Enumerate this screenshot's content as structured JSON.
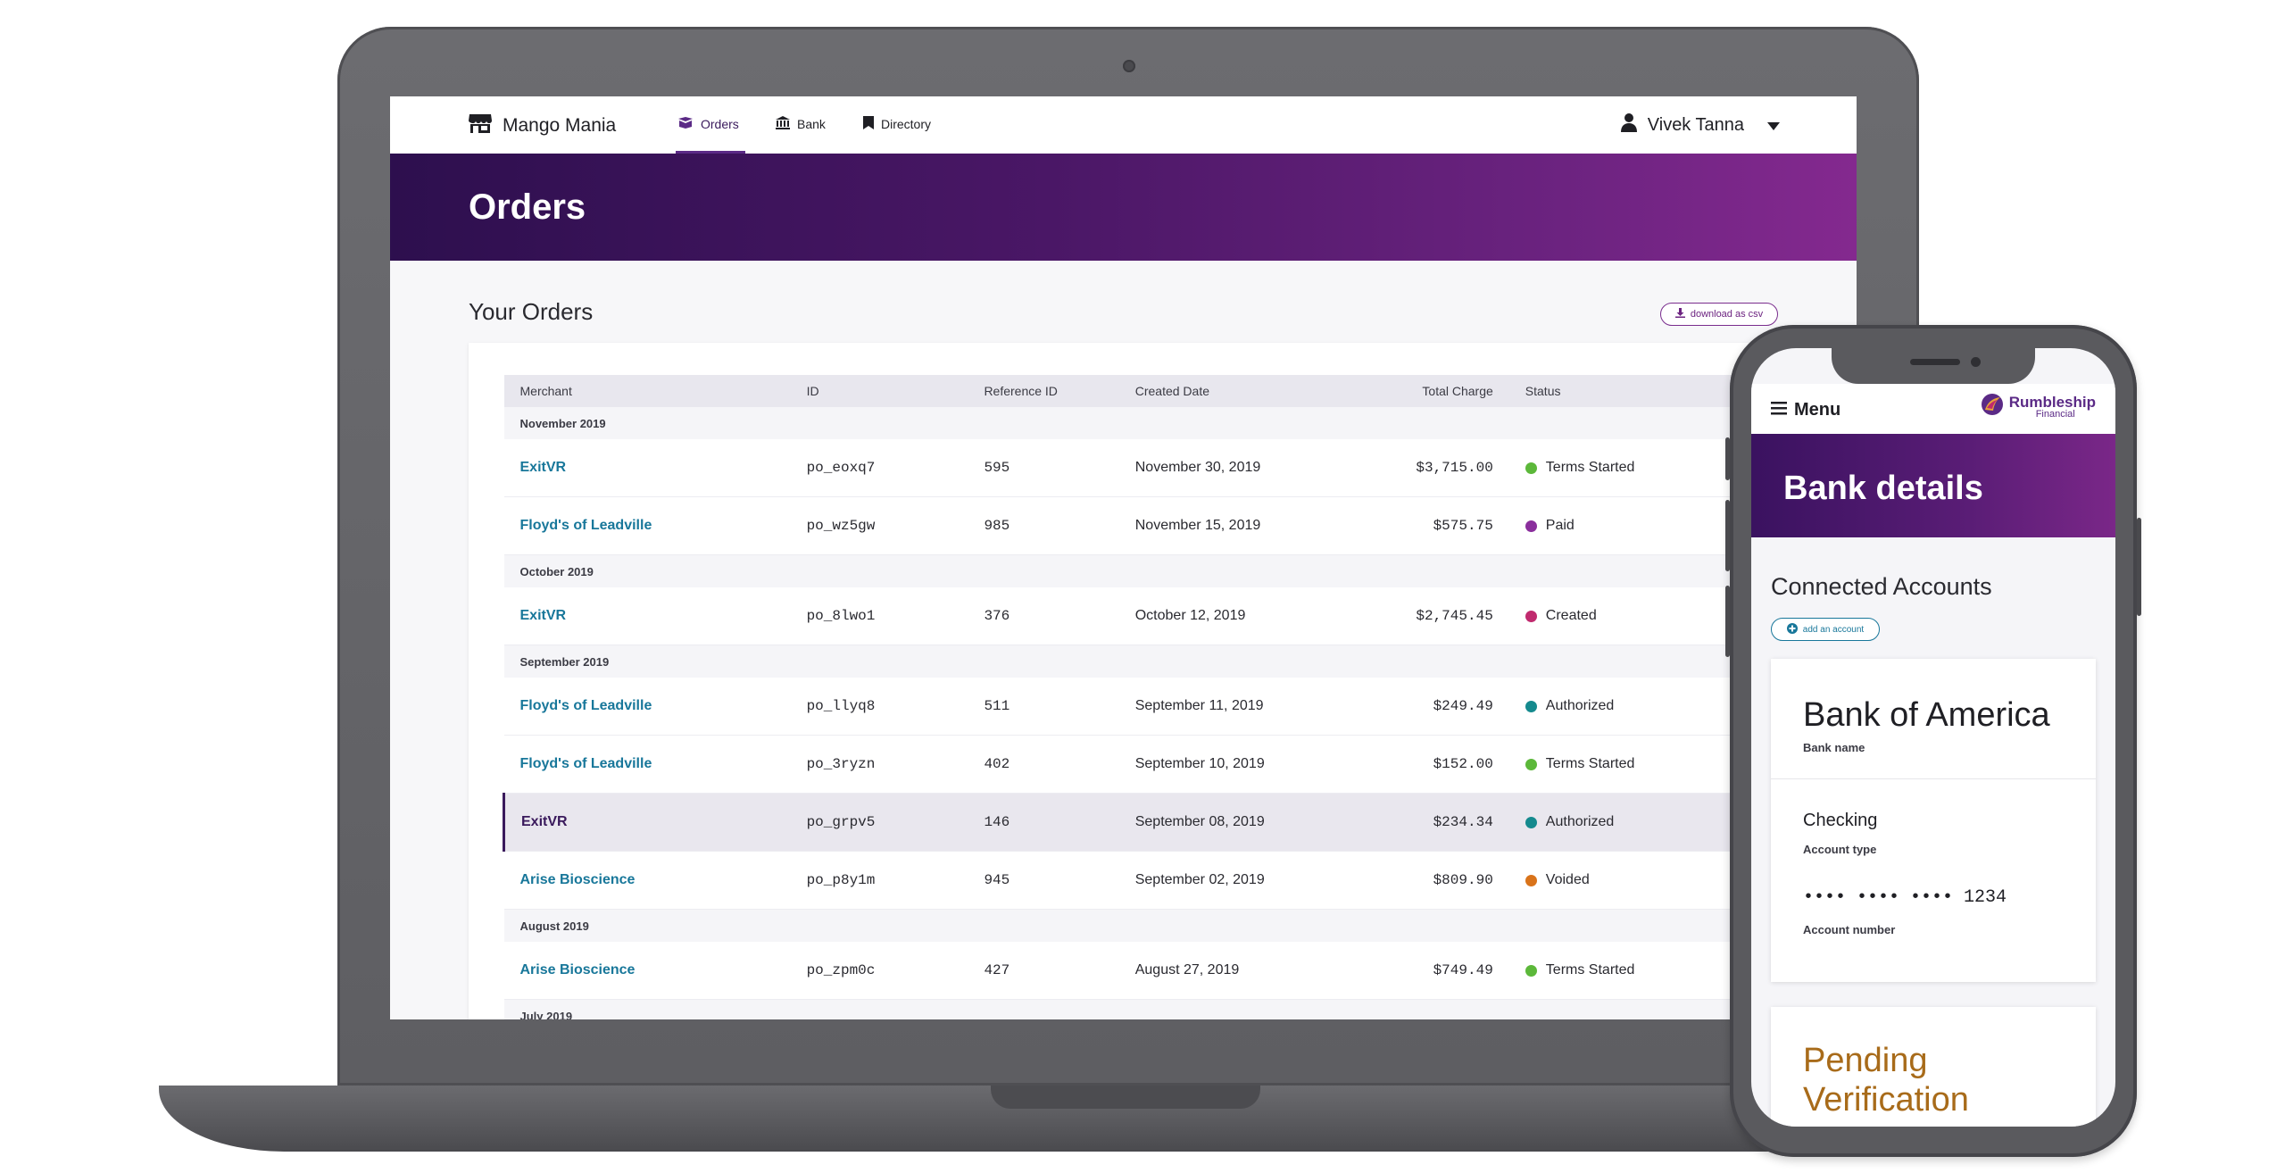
{
  "laptop": {
    "nav": {
      "brand": "Mango Mania",
      "items": [
        {
          "label": "Orders",
          "icon": "box-icon",
          "active": true
        },
        {
          "label": "Bank",
          "icon": "bank-icon",
          "active": false
        },
        {
          "label": "Directory",
          "icon": "bookmark-icon",
          "active": false
        }
      ],
      "user": "Vivek Tanna"
    },
    "page_title": "Orders",
    "section_title": "Your Orders",
    "download_label": "download as csv",
    "table": {
      "columns": [
        "Merchant",
        "ID",
        "Reference ID",
        "Created Date",
        "Total Charge",
        "Status"
      ],
      "groups": [
        {
          "label": "November 2019",
          "rows": [
            {
              "merchant": "ExitVR",
              "id": "po_eoxq7",
              "ref": "595",
              "date": "November 30, 2019",
              "total": "$3,715.00",
              "status": "Terms Started",
              "status_color": "#5cb83a"
            },
            {
              "merchant": "Floyd's of Leadville",
              "id": "po_wz5gw",
              "ref": "985",
              "date": "November 15, 2019",
              "total": "$575.75",
              "status": "Paid",
              "status_color": "#8a2f9c"
            }
          ]
        },
        {
          "label": "October 2019",
          "rows": [
            {
              "merchant": "ExitVR",
              "id": "po_8lwo1",
              "ref": "376",
              "date": "October 12, 2019",
              "total": "$2,745.45",
              "status": "Created",
              "status_color": "#c02a6e"
            }
          ]
        },
        {
          "label": "September 2019",
          "rows": [
            {
              "merchant": "Floyd's of Leadville",
              "id": "po_llyq8",
              "ref": "511",
              "date": "September 11, 2019",
              "total": "$249.49",
              "status": "Authorized",
              "status_color": "#158a8e"
            },
            {
              "merchant": "Floyd's of Leadville",
              "id": "po_3ryzn",
              "ref": "402",
              "date": "September 10, 2019",
              "total": "$152.00",
              "status": "Terms Started",
              "status_color": "#5cb83a"
            },
            {
              "merchant": "ExitVR",
              "id": "po_grpv5",
              "ref": "146",
              "date": "September 08, 2019",
              "total": "$234.34",
              "status": "Authorized",
              "status_color": "#158a8e",
              "selected": true
            },
            {
              "merchant": "Arise Bioscience",
              "id": "po_p8y1m",
              "ref": "945",
              "date": "September 02, 2019",
              "total": "$809.90",
              "status": "Voided",
              "status_color": "#d9731a"
            }
          ]
        },
        {
          "label": "August 2019",
          "rows": [
            {
              "merchant": "Arise Bioscience",
              "id": "po_zpm0c",
              "ref": "427",
              "date": "August 27, 2019",
              "total": "$749.49",
              "status": "Terms Started",
              "status_color": "#5cb83a"
            }
          ]
        },
        {
          "label": "July 2019",
          "rows": []
        }
      ]
    }
  },
  "phone": {
    "menu_label": "Menu",
    "brand_name": "Rumbleship",
    "brand_sub": "Financial",
    "page_title": "Bank details",
    "section_title": "Connected Accounts",
    "add_label": "add an account",
    "account": {
      "bank_name": "Bank of America",
      "bank_name_label": "Bank name",
      "type": "Checking",
      "type_label": "Account type",
      "number": "•••• •••• •••• 1234",
      "number_label": "Account number"
    },
    "pending": "Pending Verification"
  }
}
